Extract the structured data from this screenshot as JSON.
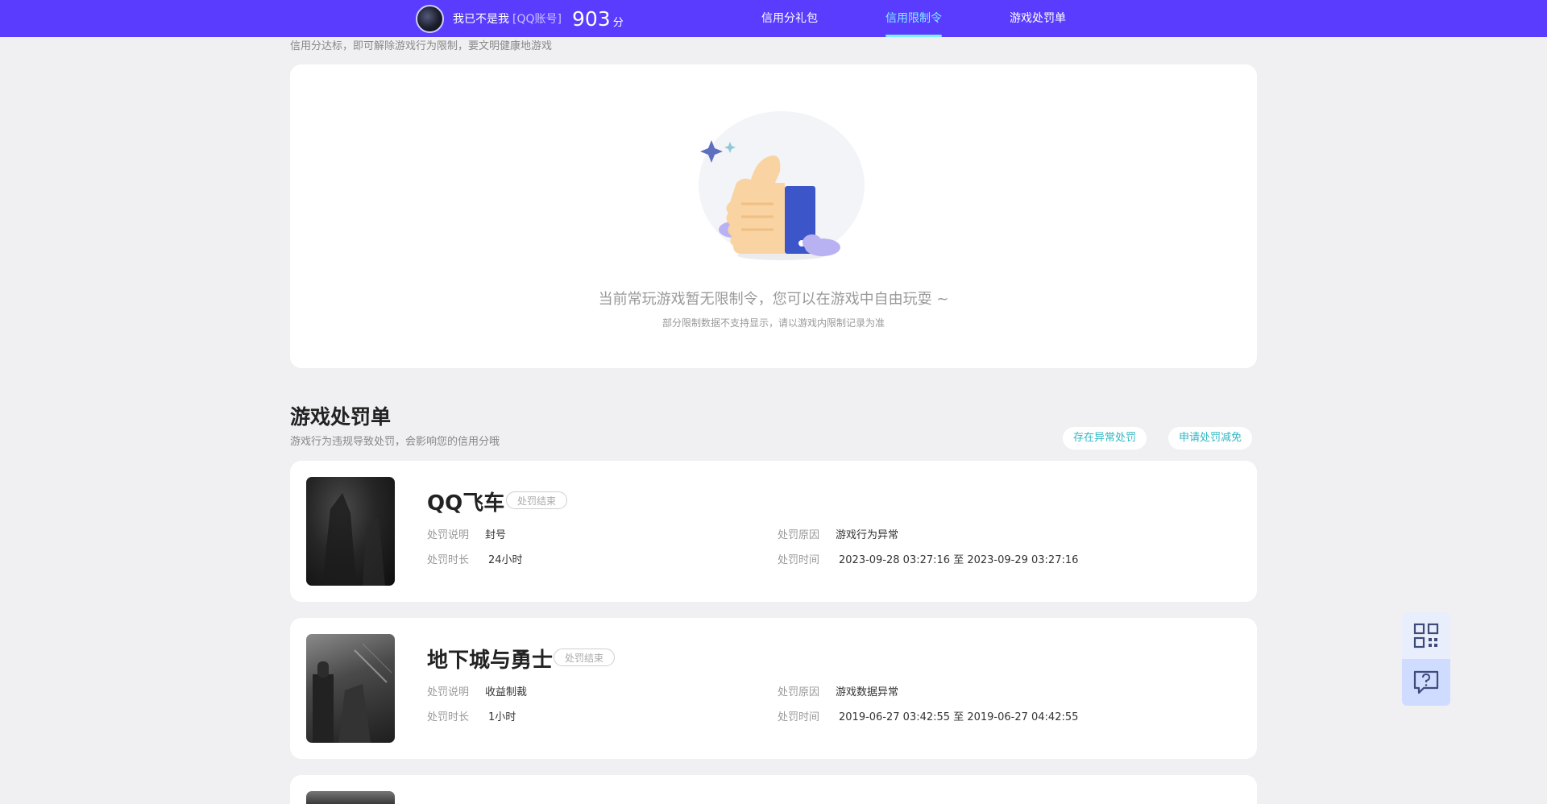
{
  "header": {
    "username": "我已不是我",
    "account_type": "[QQ账号]",
    "score": "903",
    "score_unit": "分",
    "nav": [
      "信用分礼包",
      "信用限制令",
      "游戏处罚单"
    ],
    "active_index": 1,
    "bg_color": "#5a3cff",
    "active_color": "#7ff2ff"
  },
  "restriction": {
    "description": "信用分达标，即可解除游戏行为限制，要文明健康地游戏",
    "empty_main": "当前常玩游戏暂无限制令，您可以在游戏中自由玩耍 ~",
    "empty_sub": "部分限制数据不支持显示，请以游戏内限制记录为准"
  },
  "penalty": {
    "title": "游戏处罚单",
    "description": "游戏行为违规导致处罚，会影响您的信用分哦",
    "actions": [
      "存在异常处罚",
      "申请处罚减免"
    ],
    "labels": {
      "desc": "处罚说明",
      "duration": "处罚时长",
      "reason": "处罚原因",
      "time": "处罚时间"
    },
    "items": [
      {
        "game": "QQ飞车",
        "status": "处罚结束",
        "desc": "封号",
        "duration": "24小时",
        "reason": "游戏行为异常",
        "time": "2023-09-28 03:27:16 至 2023-09-29 03:27:16"
      },
      {
        "game": "地下城与勇士",
        "status": "处罚结束",
        "desc": "收益制裁",
        "duration": "1小时",
        "reason": "游戏数据异常",
        "time": "2019-06-27 03:42:55 至 2019-06-27 04:42:55"
      }
    ]
  },
  "floating": [
    "qr-code-icon",
    "help-feedback-icon"
  ]
}
